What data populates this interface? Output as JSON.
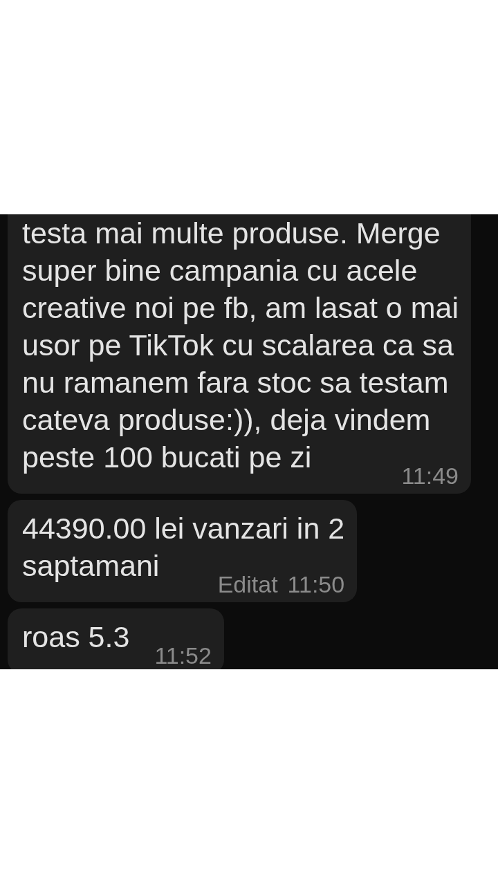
{
  "chat": {
    "messages": [
      {
        "text": "testa mai multe produse. Merge\nsuper bine campania cu acele\ncreative noi pe fb, am lasat o mai\nusor pe TikTok cu scalarea ca sa\nnu ramanem fara stoc sa testam\ncateva produse:)), deja vindem\npeste 100 bucati pe zi",
        "time": "11:49"
      },
      {
        "text": "44390.00 lei vanzari in 2\nsaptamani",
        "edited_label": "Editat",
        "time": "11:50"
      },
      {
        "text": "roas 5.3",
        "time": "11:52"
      }
    ]
  }
}
